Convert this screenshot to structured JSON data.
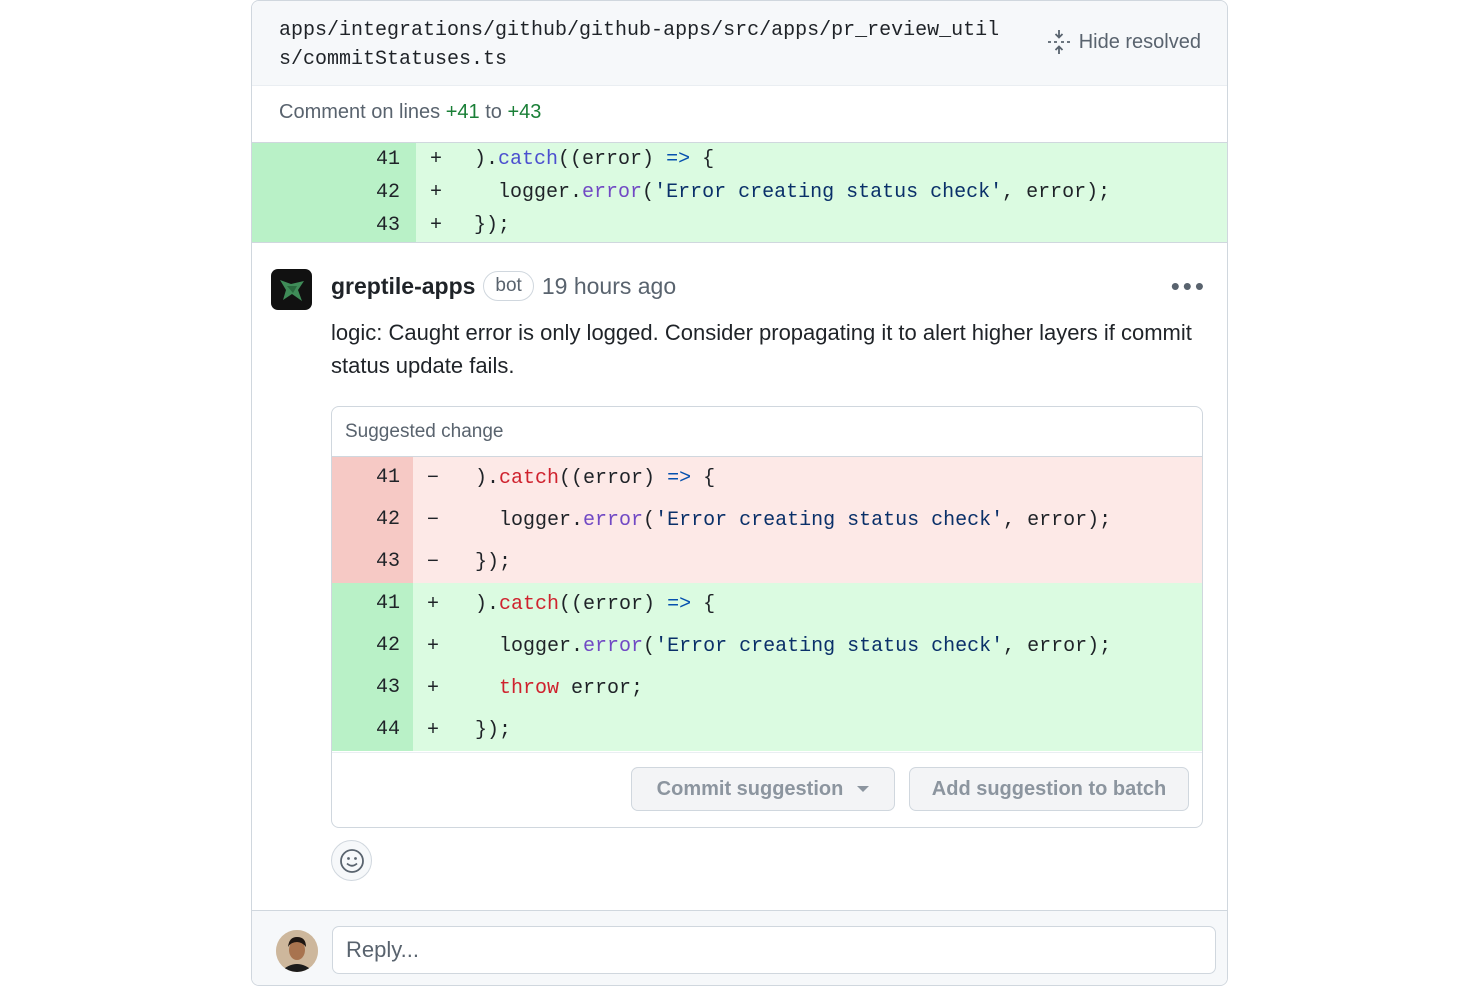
{
  "file": {
    "path": "apps/integrations/github/github-apps/src/apps/pr_review_utils/commitStatuses.ts",
    "hide_resolved_label": "Hide resolved"
  },
  "range": {
    "prefix": "Comment on lines",
    "start": "+41",
    "joiner": "to",
    "end": "+43"
  },
  "diff_lines": [
    {
      "ln": "41",
      "sign": "+",
      "code": ").catch((error) => {"
    },
    {
      "ln": "42",
      "sign": "+",
      "code": "  logger.error('Error creating status check', error);"
    },
    {
      "ln": "43",
      "sign": "+",
      "code": "});"
    }
  ],
  "comment": {
    "author": "greptile-apps",
    "badge": "bot",
    "time": "19 hours ago",
    "more_label": "•••",
    "body": "logic: Caught error is only logged. Consider propagating it to alert higher layers if commit status update fails."
  },
  "suggestion": {
    "title": "Suggested change",
    "removed": [
      {
        "ln": "41",
        "sign": "−",
        "code": ").catch((error) => {"
      },
      {
        "ln": "42",
        "sign": "−",
        "code": "  logger.error('Error creating status check', error);"
      },
      {
        "ln": "43",
        "sign": "−",
        "code": "});"
      }
    ],
    "added": [
      {
        "ln": "41",
        "sign": "+",
        "code": ").catch((error) => {"
      },
      {
        "ln": "42",
        "sign": "+",
        "code": "  logger.error('Error creating status check', error);"
      },
      {
        "ln": "43",
        "sign": "+",
        "code": "  throw error;"
      },
      {
        "ln": "44",
        "sign": "+",
        "code": "});"
      }
    ],
    "commit_label": "Commit suggestion",
    "batch_label": "Add suggestion to batch"
  },
  "reply": {
    "placeholder": "Reply..."
  },
  "colors": {
    "added_bg": "#dbfbe1",
    "added_gutter": "#b9f1c7",
    "removed_bg": "#fde9e7",
    "removed_gutter": "#f6c9c5",
    "accent_green": "#1a7f37"
  }
}
